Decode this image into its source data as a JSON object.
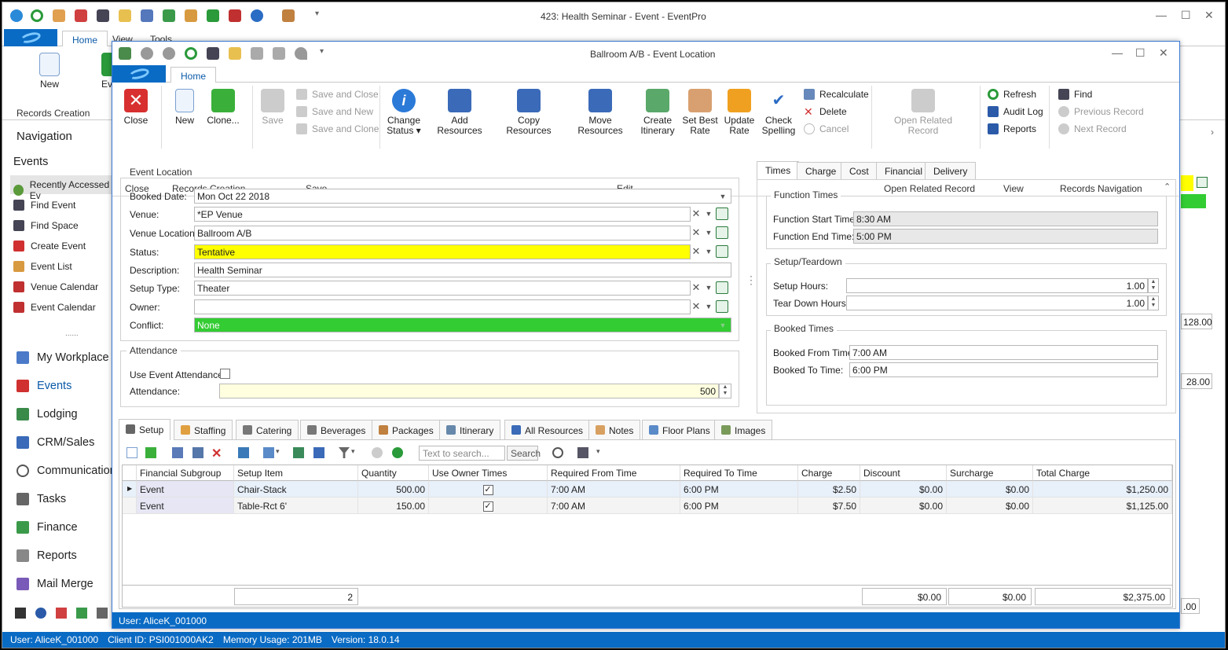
{
  "main_window": {
    "title": "423: Health Seminar - Event - EventPro",
    "tabs": [
      "Home",
      "View",
      "Tools"
    ],
    "ribbon_new": "New",
    "ribbon_ev": "Ev",
    "records_creation": "Records Creation",
    "right_field1": "128.00",
    "right_field2": "28.00",
    "right_field3": ".00"
  },
  "navigation": {
    "title": "Navigation",
    "section": "Events",
    "items": [
      "Recently Accessed Ev",
      "Find Event",
      "Find Space",
      "Create Event",
      "Event List",
      "Venue Calendar",
      "Event Calendar"
    ],
    "grip": "......",
    "modules": [
      "My Workplace",
      "Events",
      "Lodging",
      "CRM/Sales",
      "Communications",
      "Tasks",
      "Finance",
      "Reports",
      "Mail Merge"
    ]
  },
  "statusbar": {
    "user": "User: AliceK_001000",
    "client": "Client ID: PSI001000AK2",
    "memory": "Memory Usage: 201MB",
    "version": "Version: 18.0.14"
  },
  "dialog": {
    "title": "Ballroom A/B - Event Location",
    "home_tab": "Home",
    "status_user": "User: AliceK_001000",
    "ribbon": {
      "close": "Close",
      "new": "New",
      "clone": "Clone...",
      "save": "Save",
      "save_close": "Save and Close",
      "save_new": "Save and New",
      "save_clone": "Save and Clone",
      "change_status": "Change",
      "change_status2": "Status",
      "add_resources": "Add Resources",
      "copy_resources": "Copy Resources",
      "move_resources": "Move Resources",
      "create_itinerary": "Create",
      "create_itinerary2": "Itinerary",
      "set_best_rate": "Set Best",
      "set_best_rate2": "Rate",
      "update_rate": "Update",
      "update_rate2": "Rate",
      "check_spelling": "Check",
      "check_spelling2": "Spelling",
      "recalculate": "Recalculate",
      "delete": "Delete",
      "cancel": "Cancel",
      "open_related": "Open Related",
      "open_related2": "Record",
      "refresh": "Refresh",
      "audit_log": "Audit Log",
      "reports": "Reports",
      "find": "Find",
      "previous_record": "Previous Record",
      "next_record": "Next Record",
      "groups": {
        "close": "Close",
        "records_creation": "Records Creation",
        "save": "Save",
        "edit": "Edit",
        "open_related": "Open Related Record",
        "view": "View",
        "records_navigation": "Records Navigation"
      }
    },
    "event_location": {
      "title": "Event Location",
      "booked_date_label": "Booked Date:",
      "booked_date": "Mon Oct 22 2018",
      "venue_label": "Venue:",
      "venue": "*EP Venue",
      "venue_location_label": "Venue Location:",
      "venue_location": "Ballroom A/B",
      "status_label": "Status:",
      "status": "Tentative",
      "description_label": "Description:",
      "description": "Health Seminar",
      "setup_type_label": "Setup Type:",
      "setup_type": "Theater",
      "owner_label": "Owner:",
      "owner": "",
      "conflict_label": "Conflict:",
      "conflict": "None"
    },
    "attendance": {
      "title": "Attendance",
      "use_event_label": "Use Event Attendance",
      "attendance_label": "Attendance:",
      "attendance": "500"
    },
    "right_tabs": [
      "Times",
      "Charge",
      "Cost",
      "Financial",
      "Delivery"
    ],
    "times": {
      "function_times": "Function Times",
      "start_label": "Function Start Time:",
      "start": "8:30 AM",
      "end_label": "Function End Time:",
      "end": "5:00 PM",
      "setup_teardown": "Setup/Teardown",
      "setup_hours_label": "Setup Hours:",
      "setup_hours": "1.00",
      "teardown_hours_label": "Tear Down Hours:",
      "teardown_hours": "1.00",
      "booked_times": "Booked Times",
      "booked_from_label": "Booked From Time:",
      "booked_from": "7:00 AM",
      "booked_to_label": "Booked To Time:",
      "booked_to": "6:00 PM"
    },
    "bottom_tabs": [
      "Setup",
      "Staffing",
      "Catering",
      "Beverages",
      "Packages",
      "Itinerary",
      "All Resources",
      "Notes",
      "Floor Plans",
      "Images"
    ],
    "search_placeholder": "Text to search...",
    "search_button": "Search",
    "grid": {
      "columns": [
        "Financial Subgroup",
        "Setup Item",
        "Quantity",
        "Use Owner Times",
        "Required From Time",
        "Required To Time",
        "Charge",
        "Discount",
        "Surcharge",
        "Total Charge"
      ],
      "rows": [
        [
          "Event",
          "Chair-Stack",
          "500.00",
          "✓",
          "7:00 AM",
          "6:00 PM",
          "$2.50",
          "$0.00",
          "$0.00",
          "$1,250.00"
        ],
        [
          "Event",
          "Table-Rct 6'",
          "150.00",
          "✓",
          "7:00 AM",
          "6:00 PM",
          "$7.50",
          "$0.00",
          "$0.00",
          "$1,125.00"
        ]
      ],
      "footer": {
        "quantity": "2",
        "discount": "$0.00",
        "surcharge": "$0.00",
        "total": "$2,375.00"
      }
    }
  },
  "colors": {
    "accent": "#0a6bc4",
    "status_yellow": "#ffff00",
    "conflict_green": "#33cc33",
    "attendance_bg": "#ffffe0"
  }
}
